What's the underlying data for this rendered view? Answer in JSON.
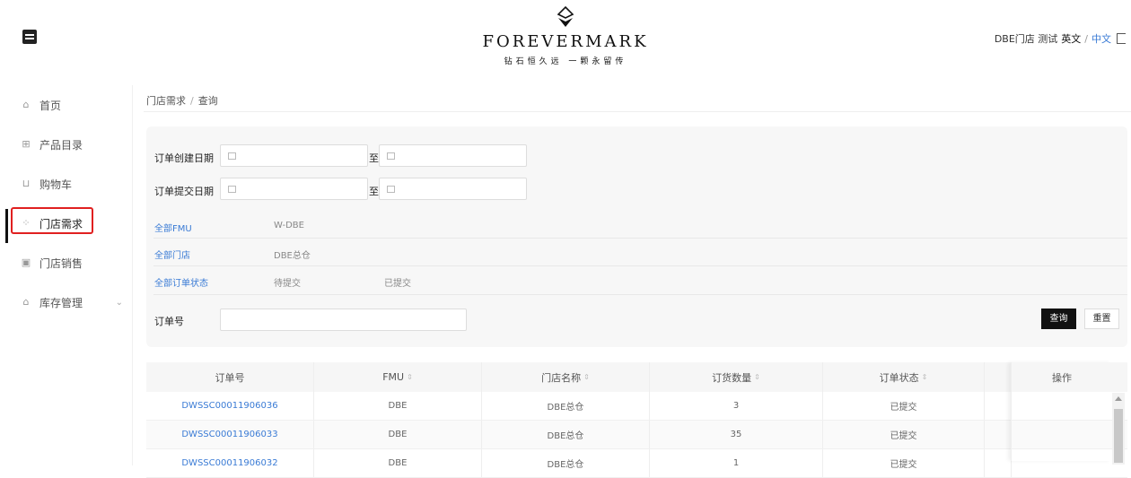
{
  "header": {
    "logo_text": "FOREVERMARK",
    "logo_sub": "钻石恒久远 一颗永留传",
    "user": "DBE门店 测试",
    "lang_en": "英文",
    "lang_sep": "/",
    "lang_zh": "中文"
  },
  "sidebar": {
    "items": [
      {
        "label": "首页",
        "icon": "home-icon"
      },
      {
        "label": "产品目录",
        "icon": "grid-icon"
      },
      {
        "label": "购物车",
        "icon": "cart-icon"
      },
      {
        "label": "门店需求",
        "icon": "apps-icon"
      },
      {
        "label": "门店销售",
        "icon": "store-icon"
      },
      {
        "label": "库存管理",
        "icon": "warehouse-icon"
      }
    ]
  },
  "breadcrumb": {
    "parent": "门店需求",
    "sep": "/",
    "current": "查询"
  },
  "filters": {
    "create_date_label": "订单创建日期",
    "submit_date_label": "订单提交日期",
    "to_label": "至",
    "fmu_all": "全部FMU",
    "fmu_opt": "W-DBE",
    "store_all": "全部门店",
    "store_opt": "DBE总仓",
    "status_all": "全部订单状态",
    "status_opt1": "待提交",
    "status_opt2": "已提交",
    "order_no_label": "订单号",
    "order_no_value": "",
    "query_btn": "查询",
    "reset_btn": "重置"
  },
  "table": {
    "headers": [
      "订单号",
      "FMU",
      "门店名称",
      "订货数量",
      "订单状态",
      "",
      "操作"
    ],
    "rows": [
      [
        "DWSSC00011906036",
        "DBE",
        "DBE总仓",
        "3",
        "已提交"
      ],
      [
        "DWSSC00011906033",
        "DBE",
        "DBE总仓",
        "35",
        "已提交"
      ],
      [
        "DWSSC00011906032",
        "DBE",
        "DBE总仓",
        "1",
        "已提交"
      ]
    ]
  }
}
